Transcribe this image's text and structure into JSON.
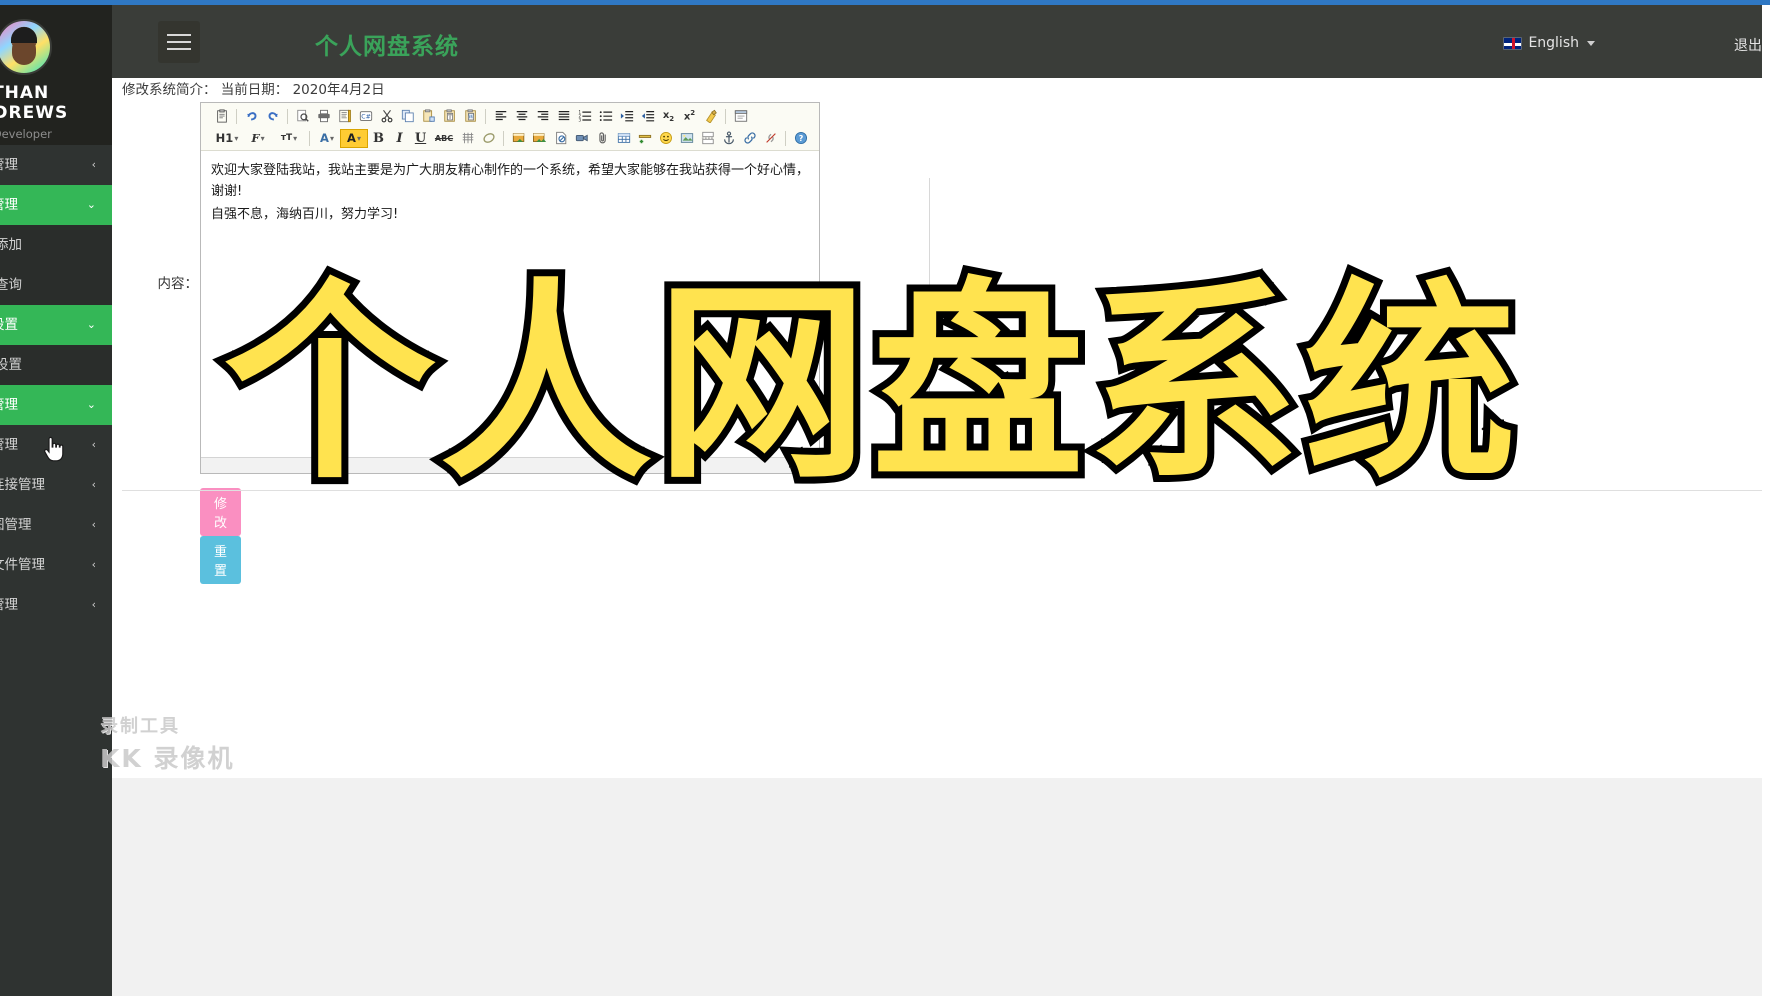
{
  "window": {
    "accent_blue": "#2f78c4",
    "sidebar_bg": "#2f3331",
    "active_green": "#34b757",
    "title_green": "#3aa35a"
  },
  "sidebar": {
    "profile": {
      "name_line1": "NATHAN",
      "name_line2": "ANDREWS",
      "role": "Web Developer",
      "avatar_icon": "user-avatar"
    },
    "items": [
      {
        "label": "用户管理",
        "state": "collapsed",
        "arrow": "‹",
        "level": 1
      },
      {
        "label": "数据管理",
        "state": "expanded",
        "arrow": "⌄",
        "level": 1
      },
      {
        "label": "信息添加",
        "state": "none",
        "arrow": "",
        "level": 2
      },
      {
        "label": "信息查询",
        "state": "none",
        "arrow": "",
        "level": 2
      },
      {
        "label": "简介设置",
        "state": "expanded",
        "arrow": "⌄",
        "level": 1
      },
      {
        "label": "简介设置",
        "state": "none",
        "arrow": "",
        "level": 2
      },
      {
        "label": "注册管理",
        "state": "expanded",
        "arrow": "⌄",
        "level": 1
      },
      {
        "label": "公告管理",
        "state": "collapsed",
        "arrow": "‹",
        "level": 1
      },
      {
        "label": "友情连接管理",
        "state": "collapsed",
        "arrow": "‹",
        "level": 1
      },
      {
        "label": "轮播图管理",
        "state": "collapsed",
        "arrow": "‹",
        "level": 1
      },
      {
        "label": "上传文件管理",
        "state": "collapsed",
        "arrow": "‹",
        "level": 1
      },
      {
        "label": "日志管理",
        "state": "collapsed",
        "arrow": "‹",
        "level": 1
      }
    ]
  },
  "header": {
    "menu_toggle_icon": "hamburger-icon",
    "app_title": "个人网盘系统",
    "language": "English",
    "language_flag": "uk-flag-icon",
    "logout": "退出"
  },
  "main": {
    "breadcrumb": "修改系统简介：  当前日期： 2020年4月2日",
    "field_label": "内容：",
    "editor": {
      "paragraphs": [
        "欢迎大家登陆我站，我站主要是为广大朋友精心制作的一个系统，希望大家能够在我站获得一个好心情，谢谢!",
        "自强不息，海纳百川，努力学习!"
      ],
      "toolbar_row1": [
        {
          "icon": "paste-icon",
          "label": ""
        },
        {
          "icon": "separator",
          "label": ""
        },
        {
          "icon": "undo-icon",
          "label": ""
        },
        {
          "icon": "redo-icon",
          "label": ""
        },
        {
          "icon": "separator",
          "label": ""
        },
        {
          "icon": "preview-icon",
          "label": ""
        },
        {
          "icon": "print-icon",
          "label": ""
        },
        {
          "icon": "template-icon",
          "label": ""
        },
        {
          "icon": "code-csharp-icon",
          "label": "C#"
        },
        {
          "icon": "cut-icon",
          "label": ""
        },
        {
          "icon": "copy-icon",
          "label": ""
        },
        {
          "icon": "paste-plain-icon",
          "label": ""
        },
        {
          "icon": "paste-text-icon",
          "label": "T"
        },
        {
          "icon": "paste-word-icon",
          "label": "W"
        },
        {
          "icon": "separator",
          "label": ""
        },
        {
          "icon": "align-left-icon",
          "label": ""
        },
        {
          "icon": "align-center-icon",
          "label": ""
        },
        {
          "icon": "align-right-icon",
          "label": ""
        },
        {
          "icon": "align-justify-icon",
          "label": ""
        },
        {
          "icon": "ordered-list-icon",
          "label": ""
        },
        {
          "icon": "unordered-list-icon",
          "label": ""
        },
        {
          "icon": "indent-icon",
          "label": ""
        },
        {
          "icon": "outdent-icon",
          "label": ""
        },
        {
          "icon": "subscript-icon",
          "label": "x₂"
        },
        {
          "icon": "superscript-icon",
          "label": "x²"
        },
        {
          "icon": "clear-format-icon",
          "label": ""
        },
        {
          "icon": "separator",
          "label": ""
        },
        {
          "icon": "source-icon",
          "label": ""
        }
      ],
      "toolbar_row2": [
        {
          "icon": "heading-icon",
          "label": "H1"
        },
        {
          "icon": "font-family-icon",
          "label": "ℱ"
        },
        {
          "icon": "font-size-icon",
          "label": "ᴛT"
        },
        {
          "icon": "separator",
          "label": ""
        },
        {
          "icon": "text-color-icon",
          "label": "A"
        },
        {
          "icon": "background-color-icon",
          "label": "A"
        },
        {
          "icon": "bold-icon",
          "label": "B"
        },
        {
          "icon": "italic-icon",
          "label": "I"
        },
        {
          "icon": "underline-icon",
          "label": "U"
        },
        {
          "icon": "strikethrough-icon",
          "label": "ABC"
        },
        {
          "icon": "remove-format-icon",
          "label": ""
        },
        {
          "icon": "eraser-icon",
          "label": ""
        },
        {
          "icon": "separator",
          "label": ""
        },
        {
          "icon": "insert-image-icon",
          "label": ""
        },
        {
          "icon": "insert-multi-image-icon",
          "label": ""
        },
        {
          "icon": "insert-file-icon",
          "label": ""
        },
        {
          "icon": "insert-video-icon",
          "label": ""
        },
        {
          "icon": "attachment-icon",
          "label": ""
        },
        {
          "icon": "insert-table-icon",
          "label": ""
        },
        {
          "icon": "horizontal-rule-icon",
          "label": ""
        },
        {
          "icon": "emoticon-icon",
          "label": ""
        },
        {
          "icon": "background-image-icon",
          "label": ""
        },
        {
          "icon": "page-break-icon",
          "label": ""
        },
        {
          "icon": "anchor-icon",
          "label": ""
        },
        {
          "icon": "link-icon",
          "label": ""
        },
        {
          "icon": "unlink-icon",
          "label": ""
        },
        {
          "icon": "separator",
          "label": ""
        },
        {
          "icon": "help-icon",
          "label": "?"
        }
      ]
    },
    "buttons": {
      "submit": "修改",
      "reset": "重置",
      "submit_color": "#fa8fc1",
      "reset_color": "#5bc0de"
    }
  },
  "overlay": {
    "watermark_text": "个人网盘系统",
    "watermark_fill": "#ffe34f",
    "watermark_stroke": "#000000",
    "recorder_line1": "录制工具",
    "recorder_line2": "KK 录像机"
  }
}
